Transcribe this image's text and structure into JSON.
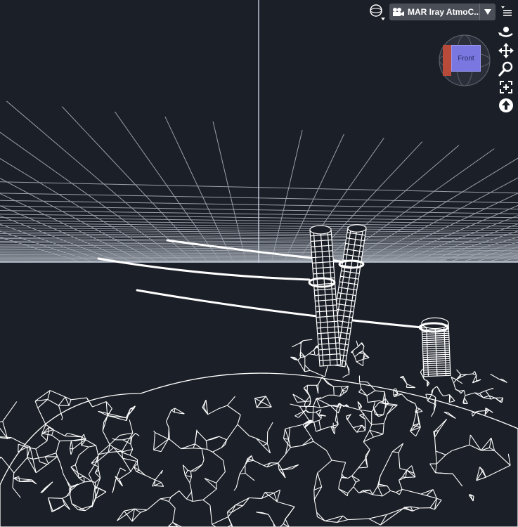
{
  "viewport": {
    "camera_label": "MAR Iray AtmoC...",
    "cube_face_label": "Front",
    "icons": {
      "view_mode": "globe-icon",
      "camera": "camera-icon",
      "dropdown": "triangle-down-icon",
      "menu": "menu-lines-icon",
      "orbit": "orbit-icon",
      "pan": "move-arrows-icon",
      "zoom": "magnifier-icon",
      "frame": "frame-icon",
      "up": "arrow-up-icon"
    },
    "colors": {
      "background": "#1b1f27",
      "wire": "#ffffff",
      "grid": "#9aa0aa",
      "axis": "#c8cfe0",
      "cube_face": "#7a78e0",
      "cube_side": "#b84a3a"
    }
  }
}
